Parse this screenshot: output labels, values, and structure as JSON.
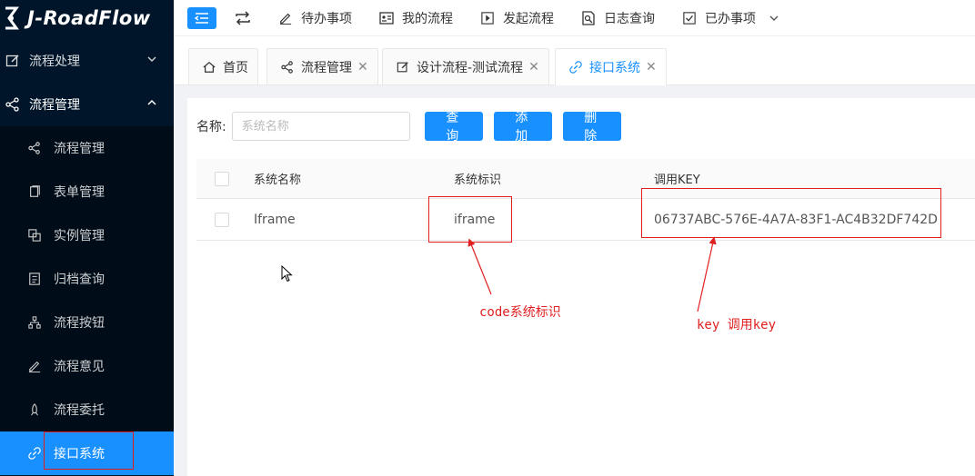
{
  "app": {
    "logo_text": "J-RoadFlow"
  },
  "sidebar": {
    "groups": [
      {
        "label": "流程处理",
        "icon": "edit-icon",
        "open": false
      },
      {
        "label": "流程管理",
        "icon": "share-icon",
        "open": true
      }
    ],
    "items": [
      {
        "label": "流程管理",
        "icon": "share-icon"
      },
      {
        "label": "表单管理",
        "icon": "copy-icon"
      },
      {
        "label": "实例管理",
        "icon": "clone-icon"
      },
      {
        "label": "归档查询",
        "icon": "archive-icon"
      },
      {
        "label": "流程按钮",
        "icon": "sitemap-icon"
      },
      {
        "label": "流程意见",
        "icon": "pen-icon"
      },
      {
        "label": "流程委托",
        "icon": "rocket-icon"
      },
      {
        "label": "接口系统",
        "icon": "link-icon",
        "active": true
      }
    ]
  },
  "topbar": {
    "items": [
      {
        "label": "待办事项",
        "icon": "pen-icon"
      },
      {
        "label": "我的流程",
        "icon": "id-card-icon"
      },
      {
        "label": "发起流程",
        "icon": "play-icon"
      },
      {
        "label": "日志查询",
        "icon": "search-doc-icon"
      },
      {
        "label": "已办事项",
        "icon": "check-square-icon"
      }
    ]
  },
  "tabs": [
    {
      "label": "首页",
      "icon": "home-icon",
      "closable": false
    },
    {
      "label": "流程管理",
      "icon": "share-icon",
      "closable": true
    },
    {
      "label": "设计流程-测试流程",
      "icon": "edit-icon",
      "closable": true
    },
    {
      "label": "接口系统",
      "icon": "link-icon",
      "closable": true,
      "active": true
    }
  ],
  "search": {
    "label": "名称:",
    "placeholder": "系统名称",
    "query_label": "查 询",
    "add_label": "添 加",
    "delete_label": "删 除"
  },
  "table": {
    "headers": [
      "系统名称",
      "系统标识",
      "调用KEY"
    ],
    "rows": [
      {
        "name": "Iframe",
        "code": "iframe",
        "key": "06737ABC-576E-4A7A-83F1-AC4B32DF742D"
      }
    ]
  },
  "annotations": {
    "code_note": "code系统标识",
    "key_note": "key 调用key",
    "color": "#e02020"
  },
  "colors": {
    "accent": "#1890ff",
    "sidebar_bg": "#001529",
    "submenu_bg": "#000c17"
  }
}
